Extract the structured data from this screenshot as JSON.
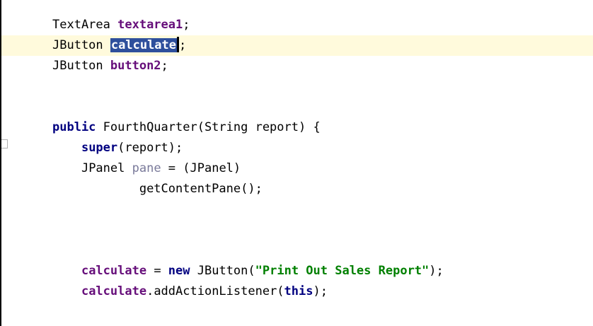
{
  "editor": {
    "lines": [
      {
        "indent": 0,
        "segments": [
          {
            "text": "TextArea ",
            "cls": ""
          },
          {
            "text": "textarea1",
            "cls": "var"
          },
          {
            "text": ";",
            "cls": ""
          }
        ]
      },
      {
        "indent": 0,
        "current": true,
        "segments": [
          {
            "text": "JButton ",
            "cls": ""
          },
          {
            "text": "calculate",
            "cls": "var sel"
          },
          {
            "caret": true
          },
          {
            "text": ";",
            "cls": ""
          }
        ]
      },
      {
        "indent": 0,
        "segments": [
          {
            "text": "JButton ",
            "cls": ""
          },
          {
            "text": "button2",
            "cls": "var"
          },
          {
            "text": ";",
            "cls": ""
          }
        ]
      },
      {
        "indent": 0,
        "segments": []
      },
      {
        "indent": 0,
        "segments": []
      },
      {
        "indent": 0,
        "segments": [
          {
            "text": "public",
            "cls": "kw"
          },
          {
            "text": " FourthQuarter(String report) {",
            "cls": ""
          }
        ]
      },
      {
        "indent": 4,
        "segments": [
          {
            "text": "super",
            "cls": "kw"
          },
          {
            "text": "(report);",
            "cls": ""
          }
        ]
      },
      {
        "indent": 4,
        "segments": [
          {
            "text": "JPanel ",
            "cls": ""
          },
          {
            "text": "pane",
            "cls": "gray"
          },
          {
            "text": " = (JPanel)",
            "cls": ""
          }
        ]
      },
      {
        "indent": 12,
        "segments": [
          {
            "text": "getContentPane();",
            "cls": ""
          }
        ]
      },
      {
        "indent": 0,
        "segments": []
      },
      {
        "indent": 0,
        "segments": []
      },
      {
        "indent": 0,
        "segments": []
      },
      {
        "indent": 4,
        "segments": [
          {
            "text": "calculate",
            "cls": "var"
          },
          {
            "text": " = ",
            "cls": ""
          },
          {
            "text": "new",
            "cls": "kw"
          },
          {
            "text": " JButton(",
            "cls": ""
          },
          {
            "text": "\"Print Out Sales Report\"",
            "cls": "str"
          },
          {
            "text": ");",
            "cls": ""
          }
        ]
      },
      {
        "indent": 4,
        "segments": [
          {
            "text": "calculate",
            "cls": "var"
          },
          {
            "text": ".addActionListener(",
            "cls": ""
          },
          {
            "text": "this",
            "cls": "kw"
          },
          {
            "text": ");",
            "cls": ""
          }
        ]
      }
    ]
  },
  "colors": {
    "keyword": "#000080",
    "field": "#660e7a",
    "string": "#008000",
    "selection": "#2e4f9c",
    "current_line": "#fffadc"
  }
}
